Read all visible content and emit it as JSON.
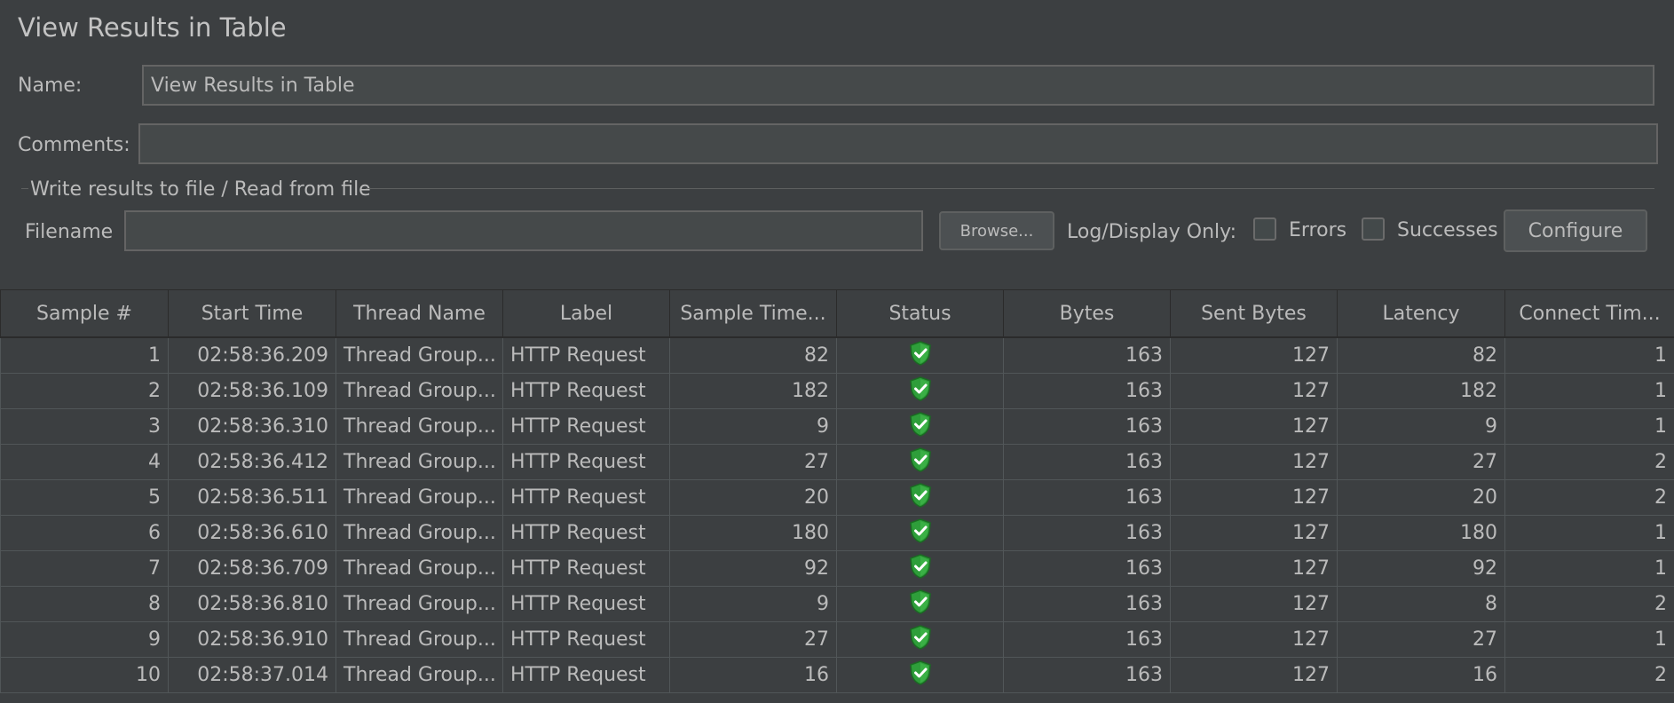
{
  "title": "View Results in Table",
  "name_label": "Name:",
  "name_value": "View Results in Table",
  "comments_label": "Comments:",
  "comments_value": "",
  "file_group_title": "Write results to file / Read from file",
  "filename_label": "Filename",
  "filename_value": "",
  "browse_label": "Browse...",
  "log_display_label": "Log/Display Only:",
  "errors_label": "Errors",
  "errors_checked": false,
  "successes_label": "Successes",
  "successes_checked": false,
  "configure_label": "Configure",
  "columns": [
    "Sample #",
    "Start Time",
    "Thread Name",
    "Label",
    "Sample Time...",
    "Status",
    "Bytes",
    "Sent Bytes",
    "Latency",
    "Connect Tim..."
  ],
  "status_icon": "success-shield-icon",
  "status_color": "#2e9e3a",
  "rows": [
    {
      "sample": "1",
      "start": "02:58:36.209",
      "thread": "Thread Group...",
      "label": "HTTP Request",
      "sample_time": "82",
      "status": "success",
      "bytes": "163",
      "sent": "127",
      "latency": "82",
      "connect": "1"
    },
    {
      "sample": "2",
      "start": "02:58:36.109",
      "thread": "Thread Group...",
      "label": "HTTP Request",
      "sample_time": "182",
      "status": "success",
      "bytes": "163",
      "sent": "127",
      "latency": "182",
      "connect": "1"
    },
    {
      "sample": "3",
      "start": "02:58:36.310",
      "thread": "Thread Group...",
      "label": "HTTP Request",
      "sample_time": "9",
      "status": "success",
      "bytes": "163",
      "sent": "127",
      "latency": "9",
      "connect": "1"
    },
    {
      "sample": "4",
      "start": "02:58:36.412",
      "thread": "Thread Group...",
      "label": "HTTP Request",
      "sample_time": "27",
      "status": "success",
      "bytes": "163",
      "sent": "127",
      "latency": "27",
      "connect": "2"
    },
    {
      "sample": "5",
      "start": "02:58:36.511",
      "thread": "Thread Group...",
      "label": "HTTP Request",
      "sample_time": "20",
      "status": "success",
      "bytes": "163",
      "sent": "127",
      "latency": "20",
      "connect": "2"
    },
    {
      "sample": "6",
      "start": "02:58:36.610",
      "thread": "Thread Group...",
      "label": "HTTP Request",
      "sample_time": "180",
      "status": "success",
      "bytes": "163",
      "sent": "127",
      "latency": "180",
      "connect": "1"
    },
    {
      "sample": "7",
      "start": "02:58:36.709",
      "thread": "Thread Group...",
      "label": "HTTP Request",
      "sample_time": "92",
      "status": "success",
      "bytes": "163",
      "sent": "127",
      "latency": "92",
      "connect": "1"
    },
    {
      "sample": "8",
      "start": "02:58:36.810",
      "thread": "Thread Group...",
      "label": "HTTP Request",
      "sample_time": "9",
      "status": "success",
      "bytes": "163",
      "sent": "127",
      "latency": "8",
      "connect": "2"
    },
    {
      "sample": "9",
      "start": "02:58:36.910",
      "thread": "Thread Group...",
      "label": "HTTP Request",
      "sample_time": "27",
      "status": "success",
      "bytes": "163",
      "sent": "127",
      "latency": "27",
      "connect": "1"
    },
    {
      "sample": "10",
      "start": "02:58:37.014",
      "thread": "Thread Group...",
      "label": "HTTP Request",
      "sample_time": "16",
      "status": "success",
      "bytes": "163",
      "sent": "127",
      "latency": "16",
      "connect": "2"
    }
  ]
}
